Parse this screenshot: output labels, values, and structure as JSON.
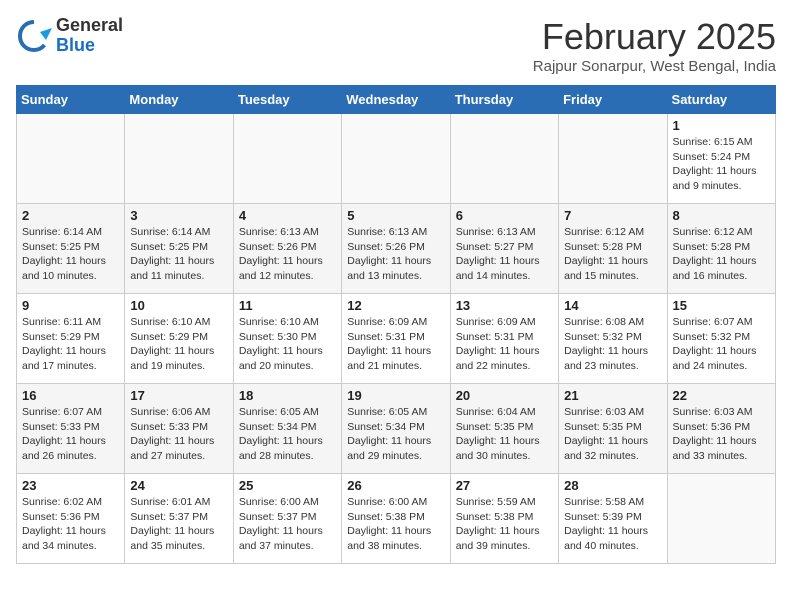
{
  "logo": {
    "general": "General",
    "blue": "Blue"
  },
  "title": "February 2025",
  "subtitle": "Rajpur Sonarpur, West Bengal, India",
  "weekdays": [
    "Sunday",
    "Monday",
    "Tuesday",
    "Wednesday",
    "Thursday",
    "Friday",
    "Saturday"
  ],
  "weeks": [
    [
      {
        "day": "",
        "info": ""
      },
      {
        "day": "",
        "info": ""
      },
      {
        "day": "",
        "info": ""
      },
      {
        "day": "",
        "info": ""
      },
      {
        "day": "",
        "info": ""
      },
      {
        "day": "",
        "info": ""
      },
      {
        "day": "1",
        "info": "Sunrise: 6:15 AM\nSunset: 5:24 PM\nDaylight: 11 hours and 9 minutes."
      }
    ],
    [
      {
        "day": "2",
        "info": "Sunrise: 6:14 AM\nSunset: 5:25 PM\nDaylight: 11 hours and 10 minutes."
      },
      {
        "day": "3",
        "info": "Sunrise: 6:14 AM\nSunset: 5:25 PM\nDaylight: 11 hours and 11 minutes."
      },
      {
        "day": "4",
        "info": "Sunrise: 6:13 AM\nSunset: 5:26 PM\nDaylight: 11 hours and 12 minutes."
      },
      {
        "day": "5",
        "info": "Sunrise: 6:13 AM\nSunset: 5:26 PM\nDaylight: 11 hours and 13 minutes."
      },
      {
        "day": "6",
        "info": "Sunrise: 6:13 AM\nSunset: 5:27 PM\nDaylight: 11 hours and 14 minutes."
      },
      {
        "day": "7",
        "info": "Sunrise: 6:12 AM\nSunset: 5:28 PM\nDaylight: 11 hours and 15 minutes."
      },
      {
        "day": "8",
        "info": "Sunrise: 6:12 AM\nSunset: 5:28 PM\nDaylight: 11 hours and 16 minutes."
      }
    ],
    [
      {
        "day": "9",
        "info": "Sunrise: 6:11 AM\nSunset: 5:29 PM\nDaylight: 11 hours and 17 minutes."
      },
      {
        "day": "10",
        "info": "Sunrise: 6:10 AM\nSunset: 5:29 PM\nDaylight: 11 hours and 19 minutes."
      },
      {
        "day": "11",
        "info": "Sunrise: 6:10 AM\nSunset: 5:30 PM\nDaylight: 11 hours and 20 minutes."
      },
      {
        "day": "12",
        "info": "Sunrise: 6:09 AM\nSunset: 5:31 PM\nDaylight: 11 hours and 21 minutes."
      },
      {
        "day": "13",
        "info": "Sunrise: 6:09 AM\nSunset: 5:31 PM\nDaylight: 11 hours and 22 minutes."
      },
      {
        "day": "14",
        "info": "Sunrise: 6:08 AM\nSunset: 5:32 PM\nDaylight: 11 hours and 23 minutes."
      },
      {
        "day": "15",
        "info": "Sunrise: 6:07 AM\nSunset: 5:32 PM\nDaylight: 11 hours and 24 minutes."
      }
    ],
    [
      {
        "day": "16",
        "info": "Sunrise: 6:07 AM\nSunset: 5:33 PM\nDaylight: 11 hours and 26 minutes."
      },
      {
        "day": "17",
        "info": "Sunrise: 6:06 AM\nSunset: 5:33 PM\nDaylight: 11 hours and 27 minutes."
      },
      {
        "day": "18",
        "info": "Sunrise: 6:05 AM\nSunset: 5:34 PM\nDaylight: 11 hours and 28 minutes."
      },
      {
        "day": "19",
        "info": "Sunrise: 6:05 AM\nSunset: 5:34 PM\nDaylight: 11 hours and 29 minutes."
      },
      {
        "day": "20",
        "info": "Sunrise: 6:04 AM\nSunset: 5:35 PM\nDaylight: 11 hours and 30 minutes."
      },
      {
        "day": "21",
        "info": "Sunrise: 6:03 AM\nSunset: 5:35 PM\nDaylight: 11 hours and 32 minutes."
      },
      {
        "day": "22",
        "info": "Sunrise: 6:03 AM\nSunset: 5:36 PM\nDaylight: 11 hours and 33 minutes."
      }
    ],
    [
      {
        "day": "23",
        "info": "Sunrise: 6:02 AM\nSunset: 5:36 PM\nDaylight: 11 hours and 34 minutes."
      },
      {
        "day": "24",
        "info": "Sunrise: 6:01 AM\nSunset: 5:37 PM\nDaylight: 11 hours and 35 minutes."
      },
      {
        "day": "25",
        "info": "Sunrise: 6:00 AM\nSunset: 5:37 PM\nDaylight: 11 hours and 37 minutes."
      },
      {
        "day": "26",
        "info": "Sunrise: 6:00 AM\nSunset: 5:38 PM\nDaylight: 11 hours and 38 minutes."
      },
      {
        "day": "27",
        "info": "Sunrise: 5:59 AM\nSunset: 5:38 PM\nDaylight: 11 hours and 39 minutes."
      },
      {
        "day": "28",
        "info": "Sunrise: 5:58 AM\nSunset: 5:39 PM\nDaylight: 11 hours and 40 minutes."
      },
      {
        "day": "",
        "info": ""
      }
    ]
  ]
}
